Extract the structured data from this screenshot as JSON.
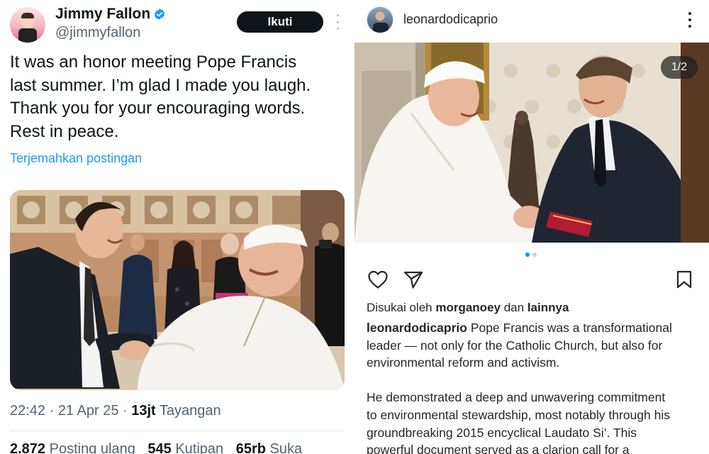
{
  "twitter": {
    "author_name": "Jimmy Fallon",
    "handle": "@jimmyfallon",
    "follow_label": "Ikuti",
    "text_lines": [
      "It was an honor meeting Pope Francis",
      "last summer. I’m glad I made you laugh.",
      "Thank you for your encouraging words.",
      "Rest in peace."
    ],
    "translate_label": "Terjemahkan postingan",
    "meta": {
      "time": "22:42",
      "date": "21 Apr 25",
      "views_count": "13jt",
      "views_label": "Tayangan"
    },
    "stats": {
      "reposts_count": "2.872",
      "reposts_label": "Posting ulang",
      "quotes_count": "545",
      "quotes_label": "Kutipan",
      "likes_count": "65rb",
      "likes_label": "Suka"
    },
    "colors": {
      "link": "#1d9bf0",
      "verified": "#1d9bf0",
      "secondary_text": "#536471"
    }
  },
  "instagram": {
    "username": "leonardodicaprio",
    "carousel_counter": "1/2",
    "carousel_pages": 2,
    "carousel_active_index": 0,
    "liked_by_prefix": "Disukai oleh",
    "liked_by_user": "morganoey",
    "liked_by_joiner": "dan",
    "liked_by_others": "lainnya",
    "caption_username": "leonardodicaprio",
    "caption_lines": [
      "Pope Francis was a transformational",
      "leader — not only for the Catholic Church, but also for",
      "environmental reform and activism."
    ],
    "caption_lines_2": [
      "He demonstrated a deep and unwavering commitment",
      "to environmental stewardship, most notably through his",
      "groundbreaking 2015 encyclical Laudato Si’. This",
      "powerful document served as a clarion call for a"
    ],
    "icons": [
      "heart-icon",
      "send-icon",
      "bookmark-icon",
      "more-vertical-icon"
    ],
    "colors": {
      "active_dot": "#0095f6",
      "text": "#262626"
    }
  }
}
